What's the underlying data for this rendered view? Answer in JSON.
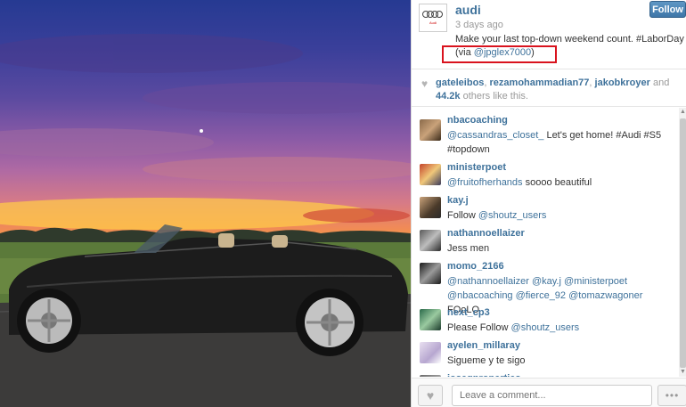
{
  "post": {
    "username": "audi",
    "time": "3 days ago",
    "caption_line1": "Make your last top-down weekend count. #LaborDay",
    "caption_via_prefix": "(via ",
    "caption_via_user": "@jpglex7000",
    "caption_via_suffix": ")",
    "follow_label": "Follow",
    "logo_text": "Audi"
  },
  "likes": {
    "user1": "gateleibos",
    "user2": "rezamohammadian77",
    "user3": "jakobkroyer",
    "and": "and",
    "count": "44.2k",
    "suffix": "others like this."
  },
  "comments": [
    {
      "user": "nbacoaching",
      "mention": "@cassandras_closet_",
      "text": " Let's get home! #Audi #S5 #topdown"
    },
    {
      "user": "ministerpoet",
      "mention": "@fruitofherhands",
      "text": " soooo beautiful"
    },
    {
      "user": "kay.j",
      "prefix": "Follow ",
      "mention": "@shoutz_users"
    },
    {
      "user": "nathannoellaizer",
      "text": "Jess men"
    },
    {
      "user": "momo_2166",
      "mention1": "@nathannoellaizer",
      "mention2": "@kay.j",
      "mention3": "@ministerpoet",
      "mention4": "@nbacoaching",
      "mention5": "@fierce_92",
      "mention6": "@tomazwagoner",
      "text": "FOoLO"
    },
    {
      "user": "next_cp3",
      "prefix": "Please Follow ",
      "mention": "@shoutz_users"
    },
    {
      "user": "ayelen_millaray",
      "text": "Sigueme y te sigo"
    },
    {
      "user": "josegproperties"
    }
  ],
  "footer": {
    "comment_placeholder": "Leave a comment...",
    "more_label": "•••"
  },
  "colors": {
    "link": "#3f729b",
    "highlight": "#d9131e",
    "follow": "#4a80b2"
  }
}
